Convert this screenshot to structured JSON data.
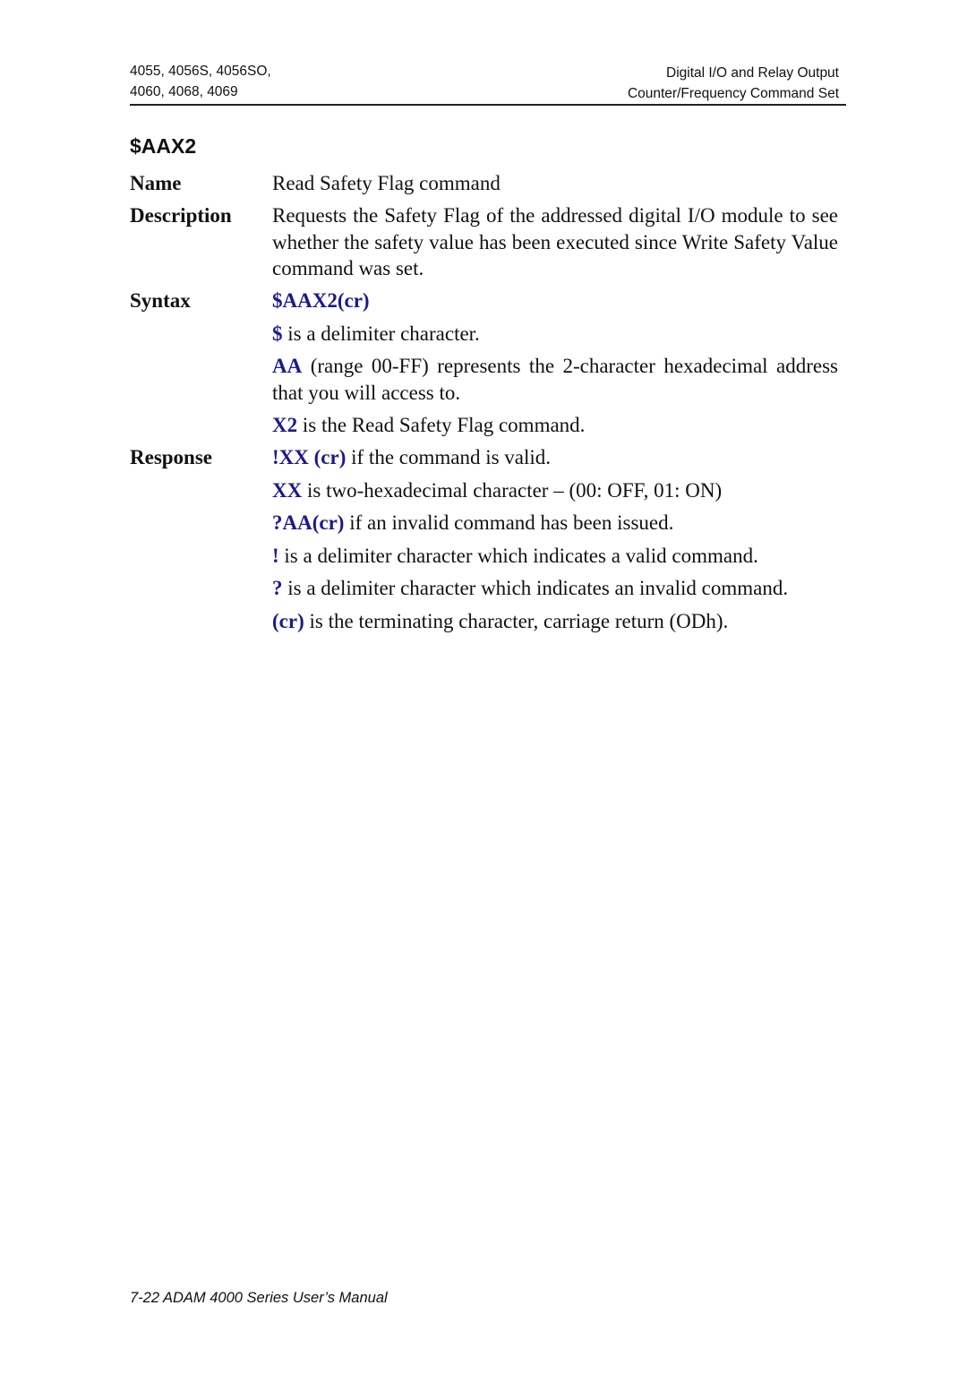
{
  "header": {
    "left_line1": "4055, 4056S, 4056SO,",
    "left_line2": "4060, 4068, 4069",
    "right_line1": "Digital I/O and Relay Output",
    "right_line2": "Counter/Frequency Command Set"
  },
  "title": "$AAX2",
  "name": {
    "label": "Name",
    "text": "Read Safety Flag command"
  },
  "description": {
    "label": "Description",
    "text": "Requests the Safety Flag of the addressed digital I/O module to see whether the safety value has been executed since Write Safety Value command was set."
  },
  "syntax": {
    "label": "Syntax",
    "command": "$AAX2(cr)",
    "items": [
      {
        "key": "$",
        "text": " is a delimiter character."
      },
      {
        "key": "AA",
        "text": " (range 00-FF) represents the 2-character hexadecimal address that you will access to."
      },
      {
        "key": "X2",
        "text": " is the Read Safety Flag command."
      }
    ]
  },
  "response": {
    "label": "Response",
    "items": [
      {
        "key": "!XX (cr)",
        "text": " if the command is valid."
      },
      {
        "key": "XX",
        "text": " is two-hexadecimal character – (00: OFF, 01: ON)"
      },
      {
        "key": "?AA(cr)",
        "text": " if an invalid command has been issued."
      },
      {
        "key": "!",
        "text": " is a delimiter character which indicates a valid command."
      },
      {
        "key": "?",
        "text": " is a delimiter character which indicates an invalid command."
      },
      {
        "key": "(cr)",
        "text": " is the terminating character, carriage return (ODh)."
      }
    ]
  },
  "footer": "7-22 ADAM 4000 Series User’s Manual"
}
